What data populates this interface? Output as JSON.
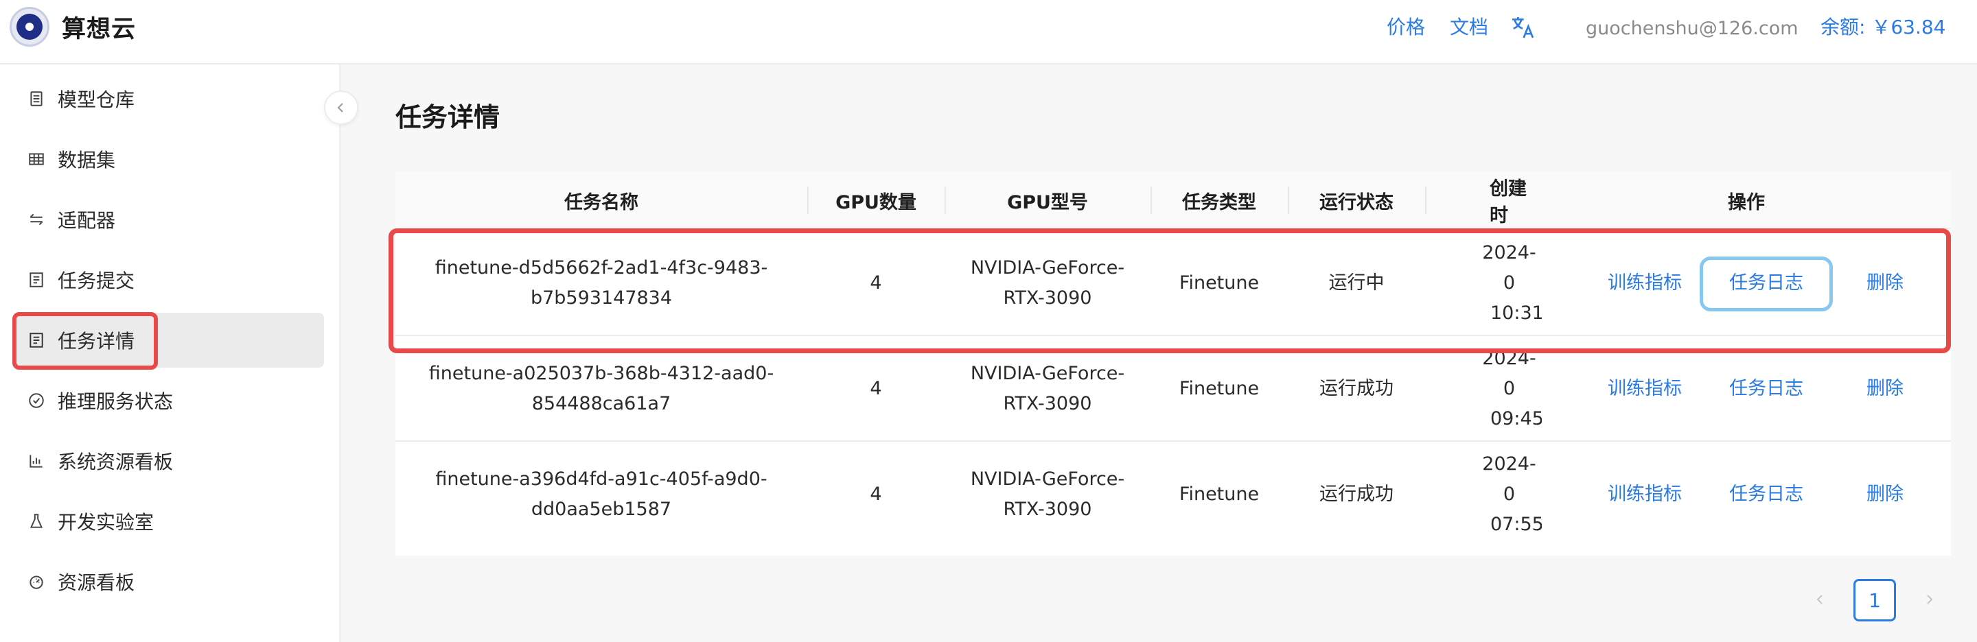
{
  "header": {
    "brand": "算想云",
    "price_label": "价格",
    "docs_label": "文档",
    "lang_icon": "translate-icon",
    "email": "guochenshu@126.com",
    "balance": "余额: ￥63.84"
  },
  "sidebar": {
    "items": [
      {
        "label": "模型仓库",
        "icon": "document-icon"
      },
      {
        "label": "数据集",
        "icon": "table-icon"
      },
      {
        "label": "适配器",
        "icon": "swap-icon"
      },
      {
        "label": "任务提交",
        "icon": "list-icon"
      },
      {
        "label": "任务详情",
        "icon": "list-icon",
        "active": true
      },
      {
        "label": "推理服务状态",
        "icon": "check-circle-icon"
      },
      {
        "label": "系统资源看板",
        "icon": "bar-chart-icon"
      },
      {
        "label": "开发实验室",
        "icon": "flask-icon"
      },
      {
        "label": "资源看板",
        "icon": "dashboard-icon"
      }
    ]
  },
  "main": {
    "title": "任务详情",
    "table": {
      "headers": [
        "任务名称",
        "GPU数量",
        "GPU型号",
        "任务类型",
        "运行状态",
        "创建时",
        "操作"
      ],
      "rows": [
        {
          "name_line1": "finetune-d5d5662f-2ad1-4f3c-9483-",
          "name_line2": "b7b593147834",
          "gpu_count": "4",
          "gpu_model_line1": "NVIDIA-GeForce-",
          "gpu_model_line2": "RTX-3090",
          "type": "Finetune",
          "status": "运行中",
          "created_line1": "2024-0",
          "created_line2": "10:31",
          "action_metrics": "训练指标",
          "action_logs": "任务日志",
          "action_delete": "删除"
        },
        {
          "name_line1": "finetune-a025037b-368b-4312-aad0-",
          "name_line2": "854488ca61a7",
          "gpu_count": "4",
          "gpu_model_line1": "NVIDIA-GeForce-",
          "gpu_model_line2": "RTX-3090",
          "type": "Finetune",
          "status": "运行成功",
          "created_line1": "2024-0",
          "created_line2": "09:45",
          "action_metrics": "训练指标",
          "action_logs": "任务日志",
          "action_delete": "删除"
        },
        {
          "name_line1": "finetune-a396d4fd-a91c-405f-a9d0-",
          "name_line2": "dd0aa5eb1587",
          "gpu_count": "4",
          "gpu_model_line1": "NVIDIA-GeForce-",
          "gpu_model_line2": "RTX-3090",
          "type": "Finetune",
          "status": "运行成功",
          "created_line1": "2024-0",
          "created_line2": "07:55",
          "action_metrics": "训练指标",
          "action_logs": "任务日志",
          "action_delete": "删除"
        }
      ]
    },
    "pagination": {
      "current_page": "1"
    }
  },
  "colors": {
    "accent": "#2a7be4",
    "highlight_red": "#e84a4a",
    "focus_blue": "#86c8f0"
  }
}
